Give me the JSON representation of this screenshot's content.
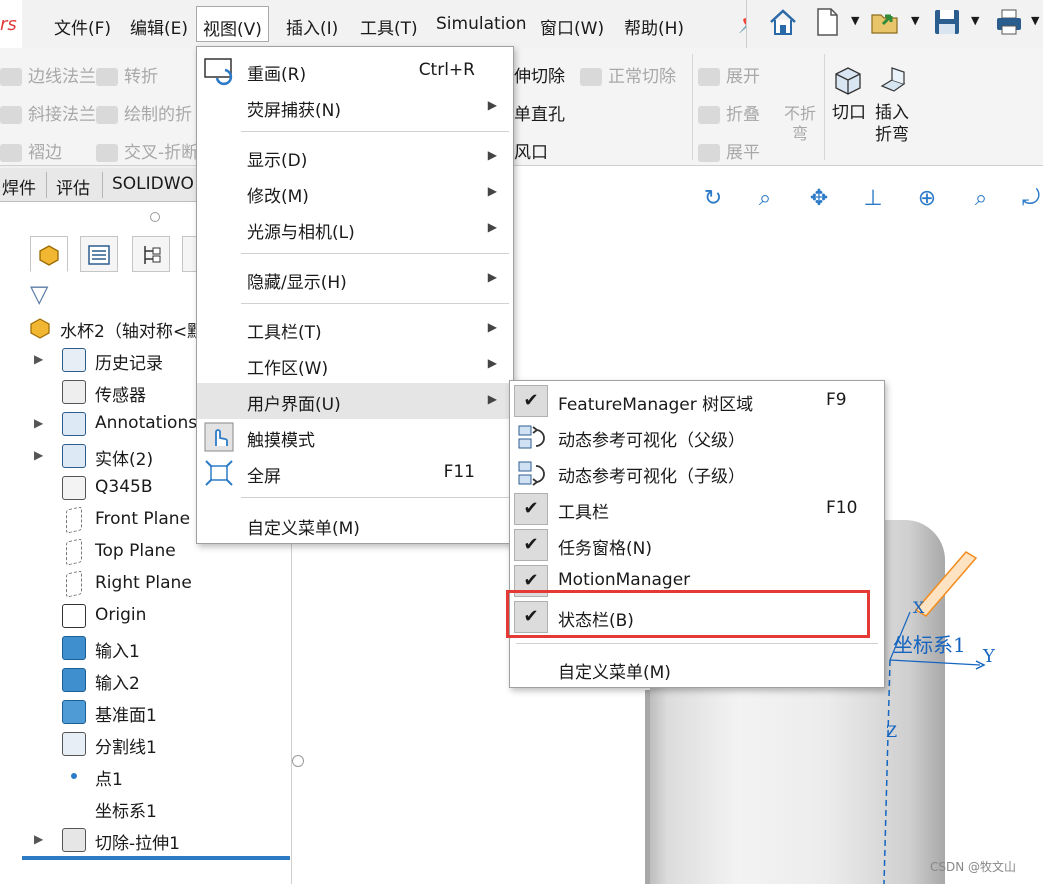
{
  "app": {
    "logo_text": "rs"
  },
  "menubar": {
    "items": [
      "文件(F)",
      "编辑(E)",
      "视图(V)",
      "插入(I)",
      "工具(T)",
      "Simulation",
      "窗口(W)",
      "帮助(H)"
    ]
  },
  "ribbon": {
    "row1": [
      "边线法兰",
      "转折",
      "伸切除",
      "正常切除",
      "展开"
    ],
    "row2": [
      "斜接法兰",
      "绘制的折",
      "单直孔",
      "折叠",
      "不折",
      "弯"
    ],
    "row3": [
      "褶边",
      "交叉-折断",
      "风口",
      "展平"
    ],
    "cut_label": "切口",
    "insert_bend_label1": "插入",
    "insert_bend_label2": "折弯"
  },
  "cmd_tabs": [
    "焊件",
    "评估",
    "SOLIDWO"
  ],
  "tree": {
    "root": "水杯2（轴对称<默",
    "items": [
      {
        "label": "历史记录",
        "expand": true
      },
      {
        "label": "传感器",
        "expand": false
      },
      {
        "label": "Annotations",
        "expand": true
      },
      {
        "label": "实体(2)",
        "expand": true
      },
      {
        "label": "Q345B",
        "expand": false
      },
      {
        "label": "Front Plane",
        "expand": false
      },
      {
        "label": "Top Plane",
        "expand": false
      },
      {
        "label": "Right Plane",
        "expand": false
      },
      {
        "label": "Origin",
        "expand": false
      },
      {
        "label": "输入1",
        "expand": false
      },
      {
        "label": "输入2",
        "expand": false
      },
      {
        "label": "基准面1",
        "expand": false
      },
      {
        "label": "分割线1",
        "expand": false
      },
      {
        "label": "点1",
        "expand": false
      },
      {
        "label": "坐标系1",
        "expand": false
      },
      {
        "label": "切除-拉伸1",
        "expand": true
      }
    ]
  },
  "view_menu": {
    "items": [
      {
        "label": "重画(R)",
        "shortcut": "Ctrl+R",
        "submenu": false
      },
      {
        "label": "荧屏捕获(N)",
        "shortcut": "",
        "submenu": true
      },
      {
        "label": "显示(D)",
        "shortcut": "",
        "submenu": true
      },
      {
        "label": "修改(M)",
        "shortcut": "",
        "submenu": true
      },
      {
        "label": "光源与相机(L)",
        "shortcut": "",
        "submenu": true
      },
      {
        "label": "隐藏/显示(H)",
        "shortcut": "",
        "submenu": true
      },
      {
        "label": "工具栏(T)",
        "shortcut": "",
        "submenu": true
      },
      {
        "label": "工作区(W)",
        "shortcut": "",
        "submenu": true
      },
      {
        "label": "用户界面(U)",
        "shortcut": "",
        "submenu": true
      },
      {
        "label": "触摸模式",
        "shortcut": "",
        "submenu": false
      },
      {
        "label": "全屏",
        "shortcut": "F11",
        "submenu": false
      },
      {
        "label": "自定义菜单(M)",
        "shortcut": "",
        "submenu": false
      }
    ]
  },
  "ui_submenu": {
    "items": [
      {
        "label": "FeatureManager 树区域",
        "shortcut": "F9",
        "checked": true
      },
      {
        "label": "动态参考可视化（父级）",
        "shortcut": "",
        "checked": false
      },
      {
        "label": "动态参考可视化（子级）",
        "shortcut": "",
        "checked": false
      },
      {
        "label": "工具栏",
        "shortcut": "F10",
        "checked": true
      },
      {
        "label": "任务窗格(N)",
        "shortcut": "",
        "checked": true
      },
      {
        "label": "MotionManager",
        "shortcut": "",
        "checked": true
      },
      {
        "label": "状态栏(B)",
        "shortcut": "",
        "checked": true
      },
      {
        "label": "自定义菜单(M)",
        "shortcut": "",
        "checked": false
      }
    ],
    "check_glyph": "✔"
  },
  "viewport": {
    "coord_label": "坐标系1",
    "axis_x": "X",
    "axis_y": "Y",
    "axis_z": "Z"
  },
  "watermark": "CSDN @牧文山",
  "colors": {
    "highlight_box": "#e53935",
    "axis": "#1565c0",
    "accent": "#2d7bc7"
  }
}
